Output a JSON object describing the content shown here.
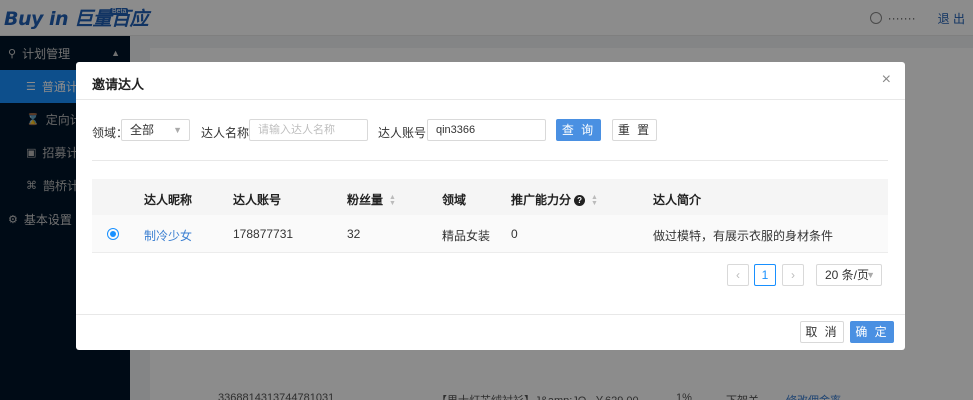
{
  "app": {
    "logo": "Buy in 巨量百应",
    "logo_badge": "Beta",
    "user_name": "·······",
    "logout": "退 出"
  },
  "sidebar": {
    "groups": [
      {
        "label": "计划管理",
        "items": [
          "普通计划",
          "定向计划",
          "招募计划",
          "鹊桥计划"
        ]
      },
      {
        "label": "基本设置"
      }
    ],
    "visible_items": [
      "普通计",
      "定向计",
      "招募计",
      "鹊桥计"
    ]
  },
  "background_row": {
    "id": "3368814313744781031",
    "title": "【男士灯芯绒衬衫】J&amp;JO",
    "price": "￥629.00",
    "rate": "1%",
    "status": "下架关",
    "action": "修改佣金率"
  },
  "modal": {
    "title": "邀请达人",
    "close": "×",
    "filters": {
      "domain_label": "领域：",
      "domain_value": "全部",
      "name_label": "达人名称：",
      "name_placeholder": "请输入达人名称",
      "account_label": "达人账号：",
      "account_value": "qin3366",
      "search_button": "查 询",
      "reset_button": "重 置"
    },
    "table": {
      "columns": [
        "达人昵称",
        "达人账号",
        "粉丝量",
        "领域",
        "推广能力分",
        "达人简介"
      ],
      "rows": [
        {
          "selected": true,
          "nickname": "制冷少女",
          "account": "178877731",
          "fans": "32",
          "domain": "精品女装",
          "score": "0",
          "intro": "做过模特，有展示衣服的身材条件"
        }
      ]
    },
    "pagination": {
      "prev": "‹",
      "current_page": "1",
      "next": "›",
      "page_size": "20 条/页"
    },
    "footer": {
      "cancel": "取 消",
      "ok": "确 定"
    }
  }
}
